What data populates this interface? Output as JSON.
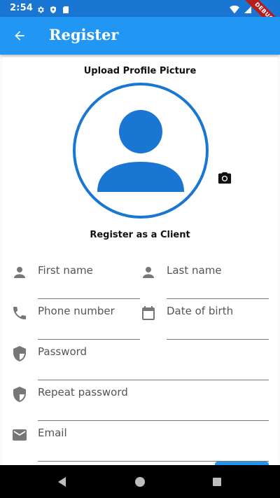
{
  "status_bar": {
    "time": "2:54",
    "debug_label": "DEBUG"
  },
  "app_bar": {
    "title": "Register",
    "back_icon": "arrow-back-icon"
  },
  "profile": {
    "upload_label": "Upload Profile Picture",
    "camera_icon": "camera-icon"
  },
  "form": {
    "section_title": "Register as a Client",
    "first_name": {
      "placeholder": "First name",
      "icon": "person-icon"
    },
    "last_name": {
      "placeholder": "Last name",
      "icon": "person-icon"
    },
    "phone": {
      "placeholder": "Phone number",
      "icon": "phone-icon"
    },
    "dob": {
      "placeholder": "Date of birth",
      "icon": "calendar-icon"
    },
    "password": {
      "placeholder": "Password",
      "icon": "shield-icon"
    },
    "repeat_password": {
      "placeholder": "Repeat password",
      "icon": "shield-icon"
    },
    "email": {
      "placeholder": "Email",
      "icon": "mail-icon"
    }
  },
  "colors": {
    "primary": "#2196f3",
    "primary_dark": "#1976d2",
    "icon_grey": "#777777"
  }
}
